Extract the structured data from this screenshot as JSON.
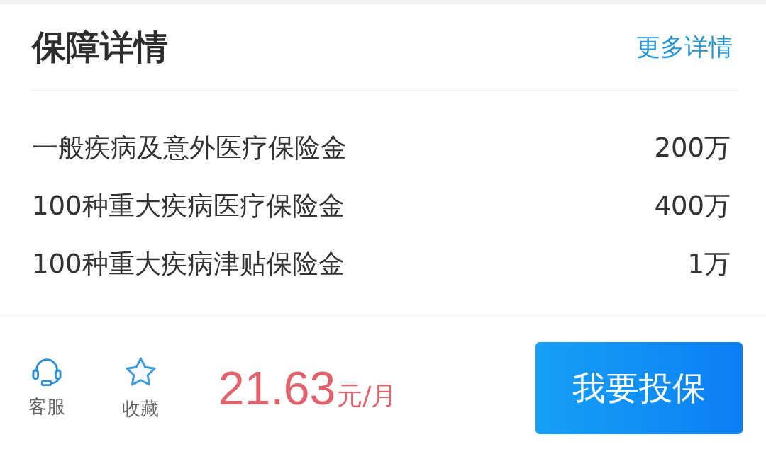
{
  "header": {
    "title": "保障详情",
    "more_link": "更多详情"
  },
  "coverage_items": [
    {
      "label": "一般疾病及意外医疗保险金",
      "value": "200万"
    },
    {
      "label": "100种重大疾病医疗保险金",
      "value": "400万"
    },
    {
      "label": "100种重大疾病津贴保险金",
      "value": "1万"
    }
  ],
  "bottom_bar": {
    "actions": [
      {
        "kind": "headset",
        "label": "客服"
      },
      {
        "kind": "star",
        "label": "收藏"
      }
    ],
    "price": {
      "amount": "21.63",
      "unit": "元/月"
    },
    "buy_button": "我要投保"
  }
}
